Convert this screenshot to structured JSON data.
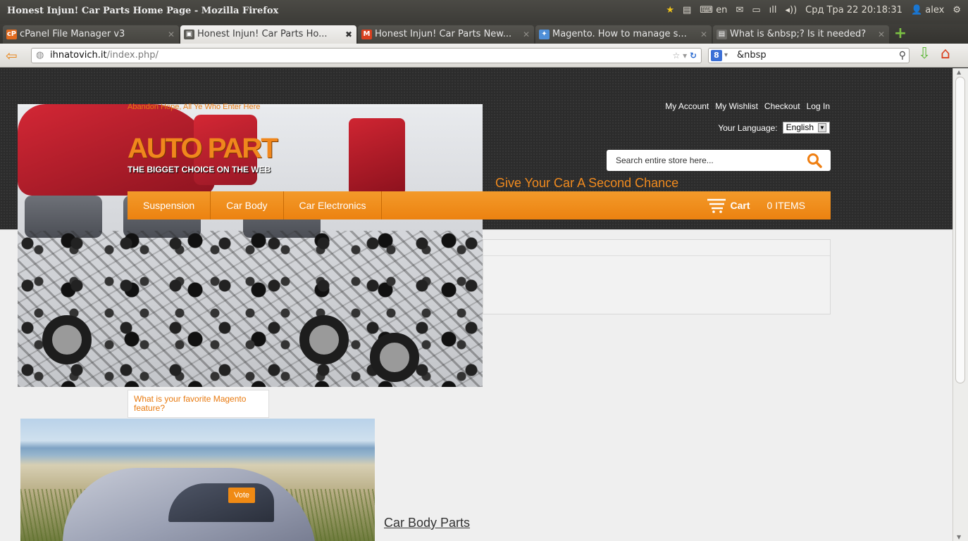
{
  "os": {
    "window_title": "Honest Injun! Car Parts Home Page - Mozilla Firefox",
    "keyboard_layout": "en",
    "clock": "Срд Тра 22 20:18:31",
    "user": "alex"
  },
  "browser": {
    "tabs": [
      {
        "label": "cPanel File Manager v3",
        "favicon": "cpanel",
        "active": false
      },
      {
        "label": "Honest Injun! Car Parts Ho...",
        "favicon": "page",
        "active": true
      },
      {
        "label": "Honest Injun! Car Parts New...",
        "favicon": "magento",
        "active": false
      },
      {
        "label": "Magento. How to manage s...",
        "favicon": "bird",
        "active": false
      },
      {
        "label": "What is &nbsp;? Is it needed?",
        "favicon": "so",
        "active": false
      }
    ],
    "url_host": "ihnatovich.it",
    "url_path": "/index.php/",
    "search_value": "&nbsp",
    "search_engine_letter": "8"
  },
  "site": {
    "tagline": "Abandon Hope, All Ye Who Enter Here",
    "logo_text": "AUTO PART",
    "logo_subtext": "THE BIGGET CHOICE ON THE WEB",
    "account_links": [
      "My Account",
      "My Wishlist",
      "Checkout",
      "Log In"
    ],
    "language_label": "Your Language:",
    "language_value": "English",
    "search_placeholder": "Search entire store here...",
    "slogan": "Give Your Car A Second Chance",
    "nav": [
      "Suspension",
      "Car Body",
      "Car Electronics"
    ],
    "cart_label": "Cart",
    "cart_count": "0 ITEMS",
    "poll_question": "What is your favorite Magento feature?",
    "vote_label": "Vote",
    "category_link": "Car Body Parts"
  },
  "colors": {
    "accent_orange": "#f08a14",
    "header_dark": "#2c2c2c",
    "page_bg": "#efefef"
  }
}
